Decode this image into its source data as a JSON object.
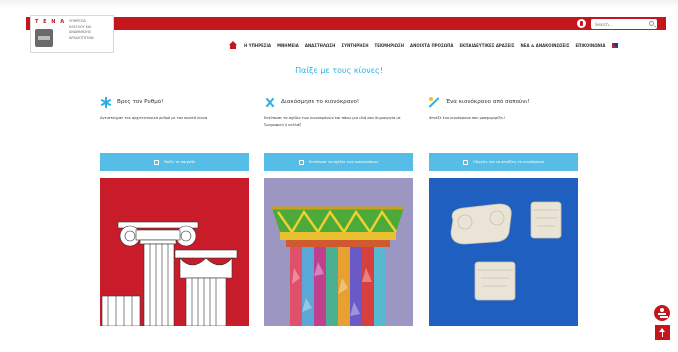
{
  "header": {
    "logo_brand": "T Ε Ν Α",
    "logo_lines": [
      "ΥΠΗΡΕΣΙΑ",
      "ΕΛΕΓΧΟΥ ΚΑΙ",
      "ΑΝΑΜΝΗΣΗΣ",
      "ΑΝΑΜΝΗΣΗΣ",
      "ΑΡΧΑΙΟΤΗΤΩΝ"
    ],
    "search_placeholder": "Search...",
    "nav": [
      "Η ΥΠΗΡΕΣΙΑ",
      "ΜΝΗΜΕΙΑ",
      "ΑΝΑΣΤΗΛΩΣΗ",
      "ΣΥΝΤΗΡΗΣΗ",
      "ΤΕΚΜΗΡΙΩΣΗ",
      "ΑΝΟΙΧΤΑ ΠΡΟΣΩΠΑ",
      "ΕΚΠΑΙΔΕΥΤΙΚΕΣ ΔΡΑΣΕΙΣ",
      "ΝΕΑ & ΑΝΑΚΟΙΝΩΣΕΙΣ",
      "ΕΠΙΚΟΙΝΩΝΙΑ"
    ]
  },
  "main": {
    "title": "Παίξε με τους κίονες!",
    "columns": [
      {
        "heading": "Βρες τον Ρυθμό!",
        "desc": "Αντιστοίχισε τον αρχιτεκτονικό ρυθμό με τον σωστό κίονα",
        "button": "Παίξε το παιχνίδι"
      },
      {
        "heading": "Διακόσμησε το κιονόκρανο!",
        "desc": "Εκτύπωσε το σχέδιο των κιονοκράνων και πάνω μια ιδιά σου δημιουργία με ζωγραφική ή κολλάζ",
        "button": "Εκτύπωσε το σχέδιο των κιονοκράνων"
      },
      {
        "heading": "Ένα κιονόκρανο από σαπούνι!",
        "desc": "Φτιάξε ένα κιονόκρανο που μοσχομυρίζει!",
        "button": "Οδηγίες για να φτιάξεις το κιονόκρανο"
      }
    ]
  },
  "colors": {
    "brand_red": "#c4161c",
    "accent_blue": "#29b2e0",
    "button_blue": "#56bde6"
  }
}
